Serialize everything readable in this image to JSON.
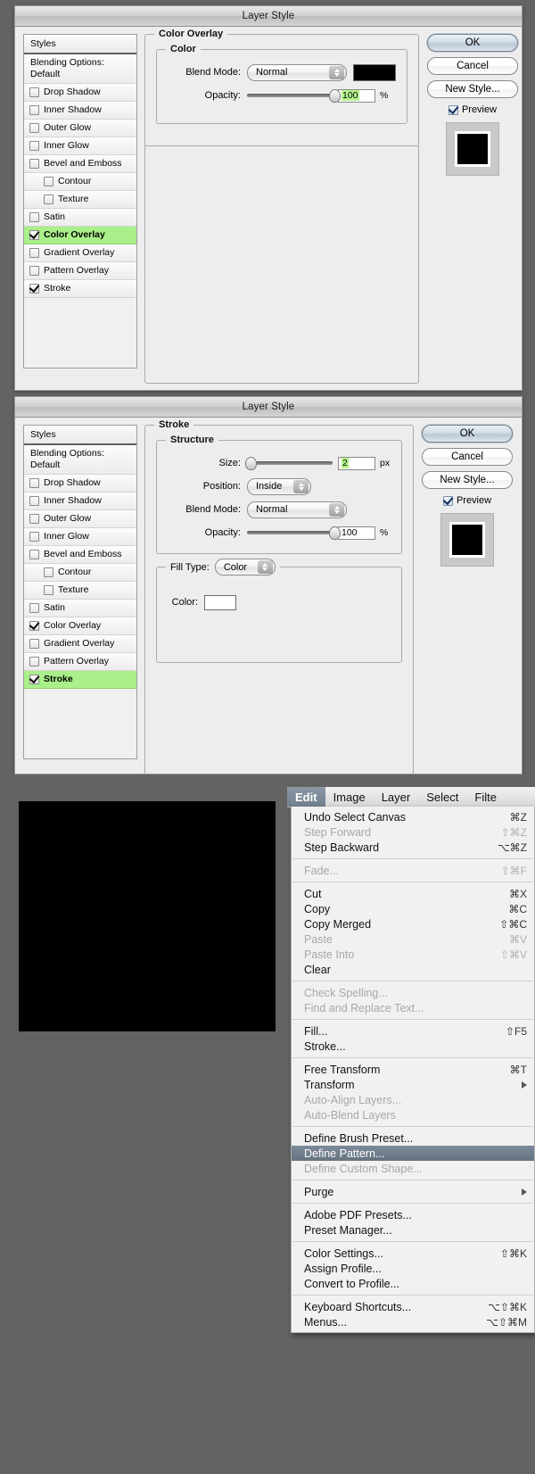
{
  "dialogs": [
    {
      "title": "Layer Style",
      "styles_header": "Styles",
      "blending_options": "Blending Options: Default",
      "style_items": [
        {
          "label": "Drop Shadow",
          "checked": false,
          "indent": false,
          "selected": false
        },
        {
          "label": "Inner Shadow",
          "checked": false,
          "indent": false,
          "selected": false
        },
        {
          "label": "Outer Glow",
          "checked": false,
          "indent": false,
          "selected": false
        },
        {
          "label": "Inner Glow",
          "checked": false,
          "indent": false,
          "selected": false
        },
        {
          "label": "Bevel and Emboss",
          "checked": false,
          "indent": false,
          "selected": false
        },
        {
          "label": "Contour",
          "checked": false,
          "indent": true,
          "selected": false
        },
        {
          "label": "Texture",
          "checked": false,
          "indent": true,
          "selected": false
        },
        {
          "label": "Satin",
          "checked": false,
          "indent": false,
          "selected": false
        },
        {
          "label": "Color Overlay",
          "checked": true,
          "indent": false,
          "selected": true
        },
        {
          "label": "Gradient Overlay",
          "checked": false,
          "indent": false,
          "selected": false
        },
        {
          "label": "Pattern Overlay",
          "checked": false,
          "indent": false,
          "selected": false
        },
        {
          "label": "Stroke",
          "checked": true,
          "indent": false,
          "selected": false
        }
      ],
      "panel": {
        "legend": "Color Overlay",
        "sub_legend": "Color",
        "blend_mode_label": "Blend Mode:",
        "blend_mode_value": "Normal",
        "color_swatch": "#000000",
        "opacity_label": "Opacity:",
        "opacity_value": "100",
        "opacity_unit": "%",
        "opacity_percent": 100
      },
      "buttons": {
        "ok": "OK",
        "cancel": "Cancel",
        "new_style": "New Style...",
        "preview": "Preview",
        "preview_checked": true
      }
    },
    {
      "title": "Layer Style",
      "styles_header": "Styles",
      "blending_options": "Blending Options: Default",
      "style_items": [
        {
          "label": "Drop Shadow",
          "checked": false,
          "indent": false,
          "selected": false
        },
        {
          "label": "Inner Shadow",
          "checked": false,
          "indent": false,
          "selected": false
        },
        {
          "label": "Outer Glow",
          "checked": false,
          "indent": false,
          "selected": false
        },
        {
          "label": "Inner Glow",
          "checked": false,
          "indent": false,
          "selected": false
        },
        {
          "label": "Bevel and Emboss",
          "checked": false,
          "indent": false,
          "selected": false
        },
        {
          "label": "Contour",
          "checked": false,
          "indent": true,
          "selected": false
        },
        {
          "label": "Texture",
          "checked": false,
          "indent": true,
          "selected": false
        },
        {
          "label": "Satin",
          "checked": false,
          "indent": false,
          "selected": false
        },
        {
          "label": "Color Overlay",
          "checked": true,
          "indent": false,
          "selected": false
        },
        {
          "label": "Gradient Overlay",
          "checked": false,
          "indent": false,
          "selected": false
        },
        {
          "label": "Pattern Overlay",
          "checked": false,
          "indent": false,
          "selected": false
        },
        {
          "label": "Stroke",
          "checked": true,
          "indent": false,
          "selected": true
        }
      ],
      "panel": {
        "legend": "Stroke",
        "sub_legend": "Structure",
        "size_label": "Size:",
        "size_value": "2",
        "size_unit": "px",
        "size_percent": 2,
        "position_label": "Position:",
        "position_value": "Inside",
        "blend_mode_label": "Blend Mode:",
        "blend_mode_value": "Normal",
        "opacity_label": "Opacity:",
        "opacity_value": "100",
        "opacity_unit": "%",
        "opacity_percent": 100,
        "fill_type_label": "Fill Type:",
        "fill_type_value": "Color",
        "color_label": "Color:",
        "color_swatch": "#ffffff"
      },
      "buttons": {
        "ok": "OK",
        "cancel": "Cancel",
        "new_style": "New Style...",
        "preview": "Preview",
        "preview_checked": true
      }
    }
  ],
  "menubar": {
    "items": [
      "Edit",
      "Image",
      "Layer",
      "Select",
      "Filte"
    ],
    "active": "Edit"
  },
  "edit_menu": [
    {
      "label": "Undo Select Canvas",
      "shortcut": "⌘Z",
      "disabled": false,
      "highlighted": false,
      "submenu": false
    },
    {
      "label": "Step Forward",
      "shortcut": "⇧⌘Z",
      "disabled": true,
      "highlighted": false,
      "submenu": false
    },
    {
      "label": "Step Backward",
      "shortcut": "⌥⌘Z",
      "disabled": false,
      "highlighted": false,
      "submenu": false
    },
    {
      "separator": true
    },
    {
      "label": "Fade...",
      "shortcut": "⇧⌘F",
      "disabled": true,
      "highlighted": false,
      "submenu": false
    },
    {
      "separator": true
    },
    {
      "label": "Cut",
      "shortcut": "⌘X",
      "disabled": false,
      "highlighted": false,
      "submenu": false
    },
    {
      "label": "Copy",
      "shortcut": "⌘C",
      "disabled": false,
      "highlighted": false,
      "submenu": false
    },
    {
      "label": "Copy Merged",
      "shortcut": "⇧⌘C",
      "disabled": false,
      "highlighted": false,
      "submenu": false
    },
    {
      "label": "Paste",
      "shortcut": "⌘V",
      "disabled": true,
      "highlighted": false,
      "submenu": false
    },
    {
      "label": "Paste Into",
      "shortcut": "⇧⌘V",
      "disabled": true,
      "highlighted": false,
      "submenu": false
    },
    {
      "label": "Clear",
      "shortcut": "",
      "disabled": false,
      "highlighted": false,
      "submenu": false
    },
    {
      "separator": true
    },
    {
      "label": "Check Spelling...",
      "shortcut": "",
      "disabled": true,
      "highlighted": false,
      "submenu": false
    },
    {
      "label": "Find and Replace Text...",
      "shortcut": "",
      "disabled": true,
      "highlighted": false,
      "submenu": false
    },
    {
      "separator": true
    },
    {
      "label": "Fill...",
      "shortcut": "⇧F5",
      "disabled": false,
      "highlighted": false,
      "submenu": false
    },
    {
      "label": "Stroke...",
      "shortcut": "",
      "disabled": false,
      "highlighted": false,
      "submenu": false
    },
    {
      "separator": true
    },
    {
      "label": "Free Transform",
      "shortcut": "⌘T",
      "disabled": false,
      "highlighted": false,
      "submenu": false
    },
    {
      "label": "Transform",
      "shortcut": "",
      "disabled": false,
      "highlighted": false,
      "submenu": true
    },
    {
      "label": "Auto-Align Layers...",
      "shortcut": "",
      "disabled": true,
      "highlighted": false,
      "submenu": false
    },
    {
      "label": "Auto-Blend Layers",
      "shortcut": "",
      "disabled": true,
      "highlighted": false,
      "submenu": false
    },
    {
      "separator": true
    },
    {
      "label": "Define Brush Preset...",
      "shortcut": "",
      "disabled": false,
      "highlighted": false,
      "submenu": false
    },
    {
      "label": "Define Pattern...",
      "shortcut": "",
      "disabled": false,
      "highlighted": true,
      "submenu": false
    },
    {
      "label": "Define Custom Shape...",
      "shortcut": "",
      "disabled": true,
      "highlighted": false,
      "submenu": false
    },
    {
      "separator": true
    },
    {
      "label": "Purge",
      "shortcut": "",
      "disabled": false,
      "highlighted": false,
      "submenu": true
    },
    {
      "separator": true
    },
    {
      "label": "Adobe PDF Presets...",
      "shortcut": "",
      "disabled": false,
      "highlighted": false,
      "submenu": false
    },
    {
      "label": "Preset Manager...",
      "shortcut": "",
      "disabled": false,
      "highlighted": false,
      "submenu": false
    },
    {
      "separator": true
    },
    {
      "label": "Color Settings...",
      "shortcut": "⇧⌘K",
      "disabled": false,
      "highlighted": false,
      "submenu": false
    },
    {
      "label": "Assign Profile...",
      "shortcut": "",
      "disabled": false,
      "highlighted": false,
      "submenu": false
    },
    {
      "label": "Convert to Profile...",
      "shortcut": "",
      "disabled": false,
      "highlighted": false,
      "submenu": false
    },
    {
      "separator": true
    },
    {
      "label": "Keyboard Shortcuts...",
      "shortcut": "⌥⇧⌘K",
      "disabled": false,
      "highlighted": false,
      "submenu": false
    },
    {
      "label": "Menus...",
      "shortcut": "⌥⇧⌘M",
      "disabled": false,
      "highlighted": false,
      "submenu": false
    }
  ],
  "canvas": {
    "fill_color": "#000000",
    "selection": "marching-ants"
  }
}
